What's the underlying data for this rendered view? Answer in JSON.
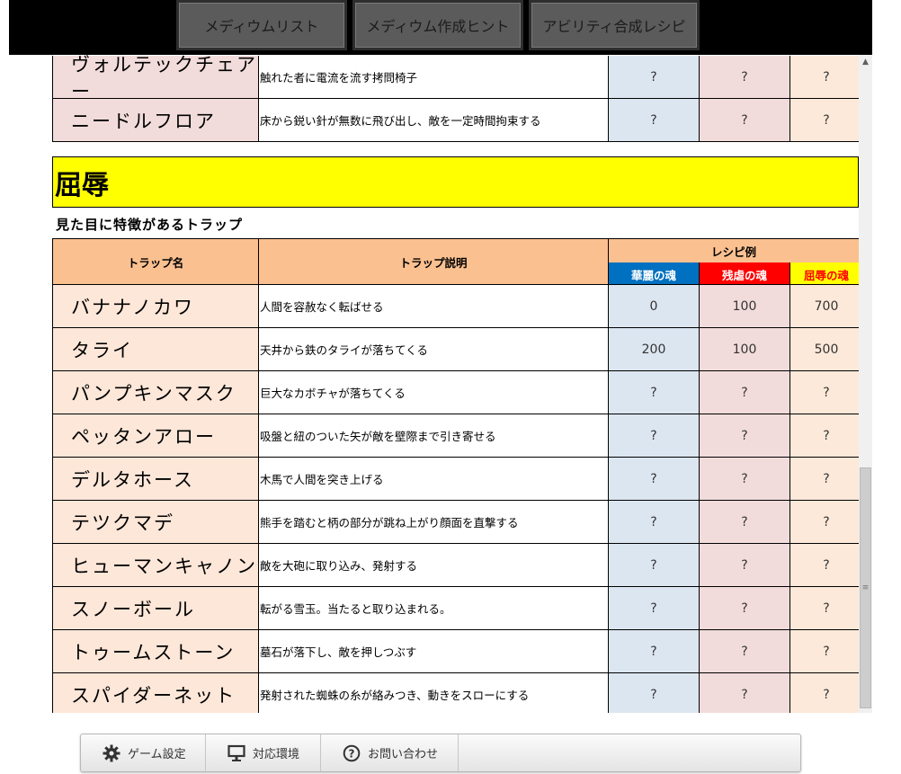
{
  "top_nav": {
    "buttons": [
      "メディウムリスト",
      "メディウム作成ヒント",
      "アビリティ合成レシピ"
    ]
  },
  "prev_rows": [
    {
      "name": "ヴォルテックチェアー",
      "desc": "触れた者に電流を流す拷問椅子",
      "v1": "?",
      "v2": "?",
      "v3": "?"
    },
    {
      "name": "ニードルフロア",
      "desc": "床から鋭い針が無数に飛び出し、敵を一定時間拘束する",
      "v1": "?",
      "v2": "?",
      "v3": "?"
    }
  ],
  "section": {
    "title": "屈辱",
    "subtitle": "見た目に特徴があるトラップ"
  },
  "table_header": {
    "name": "トラップ名",
    "desc": "トラップ説明",
    "recipe": "レシピ例",
    "soul1": "華麗の魂",
    "soul2": "残虐の魂",
    "soul3": "屈辱の魂"
  },
  "colors": {
    "soul1_bg": "#0070c0",
    "soul1_fg": "#ffffff",
    "soul2_bg": "#ff0000",
    "soul2_fg": "#ffffff",
    "soul3_bg": "#ffff00",
    "soul3_fg": "#ff0000",
    "section_bg": "#ffff00"
  },
  "rows": [
    {
      "name": "バナナノカワ",
      "desc": "人間を容赦なく転ばせる",
      "v1": "0",
      "v2": "100",
      "v3": "700"
    },
    {
      "name": "タライ",
      "desc": "天井から鉄のタライが落ちてくる",
      "v1": "200",
      "v2": "100",
      "v3": "500"
    },
    {
      "name": "パンプキンマスク",
      "desc": "巨大なカボチャが落ちてくる",
      "v1": "?",
      "v2": "?",
      "v3": "?"
    },
    {
      "name": "ペッタンアロー",
      "desc": "吸盤と紐のついた矢が敵を壁際まで引き寄せる",
      "v1": "?",
      "v2": "?",
      "v3": "?"
    },
    {
      "name": "デルタホース",
      "desc": "木馬で人間を突き上げる",
      "v1": "?",
      "v2": "?",
      "v3": "?"
    },
    {
      "name": "テツクマデ",
      "desc": "熊手を踏むと柄の部分が跳ね上がり顔面を直撃する",
      "v1": "?",
      "v2": "?",
      "v3": "?"
    },
    {
      "name": "ヒューマンキャノン",
      "desc": "敵を大砲に取り込み、発射する",
      "v1": "?",
      "v2": "?",
      "v3": "?"
    },
    {
      "name": "スノーボール",
      "desc": "転がる雪玉。当たると取り込まれる。",
      "v1": "?",
      "v2": "?",
      "v3": "?"
    },
    {
      "name": "トゥームストーン",
      "desc": "墓石が落下し、敵を押しつぶす",
      "v1": "?",
      "v2": "?",
      "v3": "?"
    },
    {
      "name": "スパイダーネット",
      "desc": "発射された蜘蛛の糸が絡みつき、動きをスローにする",
      "v1": "?",
      "v2": "?",
      "v3": "?"
    }
  ],
  "bottom_bar": {
    "items": [
      {
        "label": "ゲーム設定",
        "icon": "gear-icon"
      },
      {
        "label": "対応環境",
        "icon": "monitor-icon"
      },
      {
        "label": "お問い合わせ",
        "icon": "question-icon"
      }
    ]
  }
}
